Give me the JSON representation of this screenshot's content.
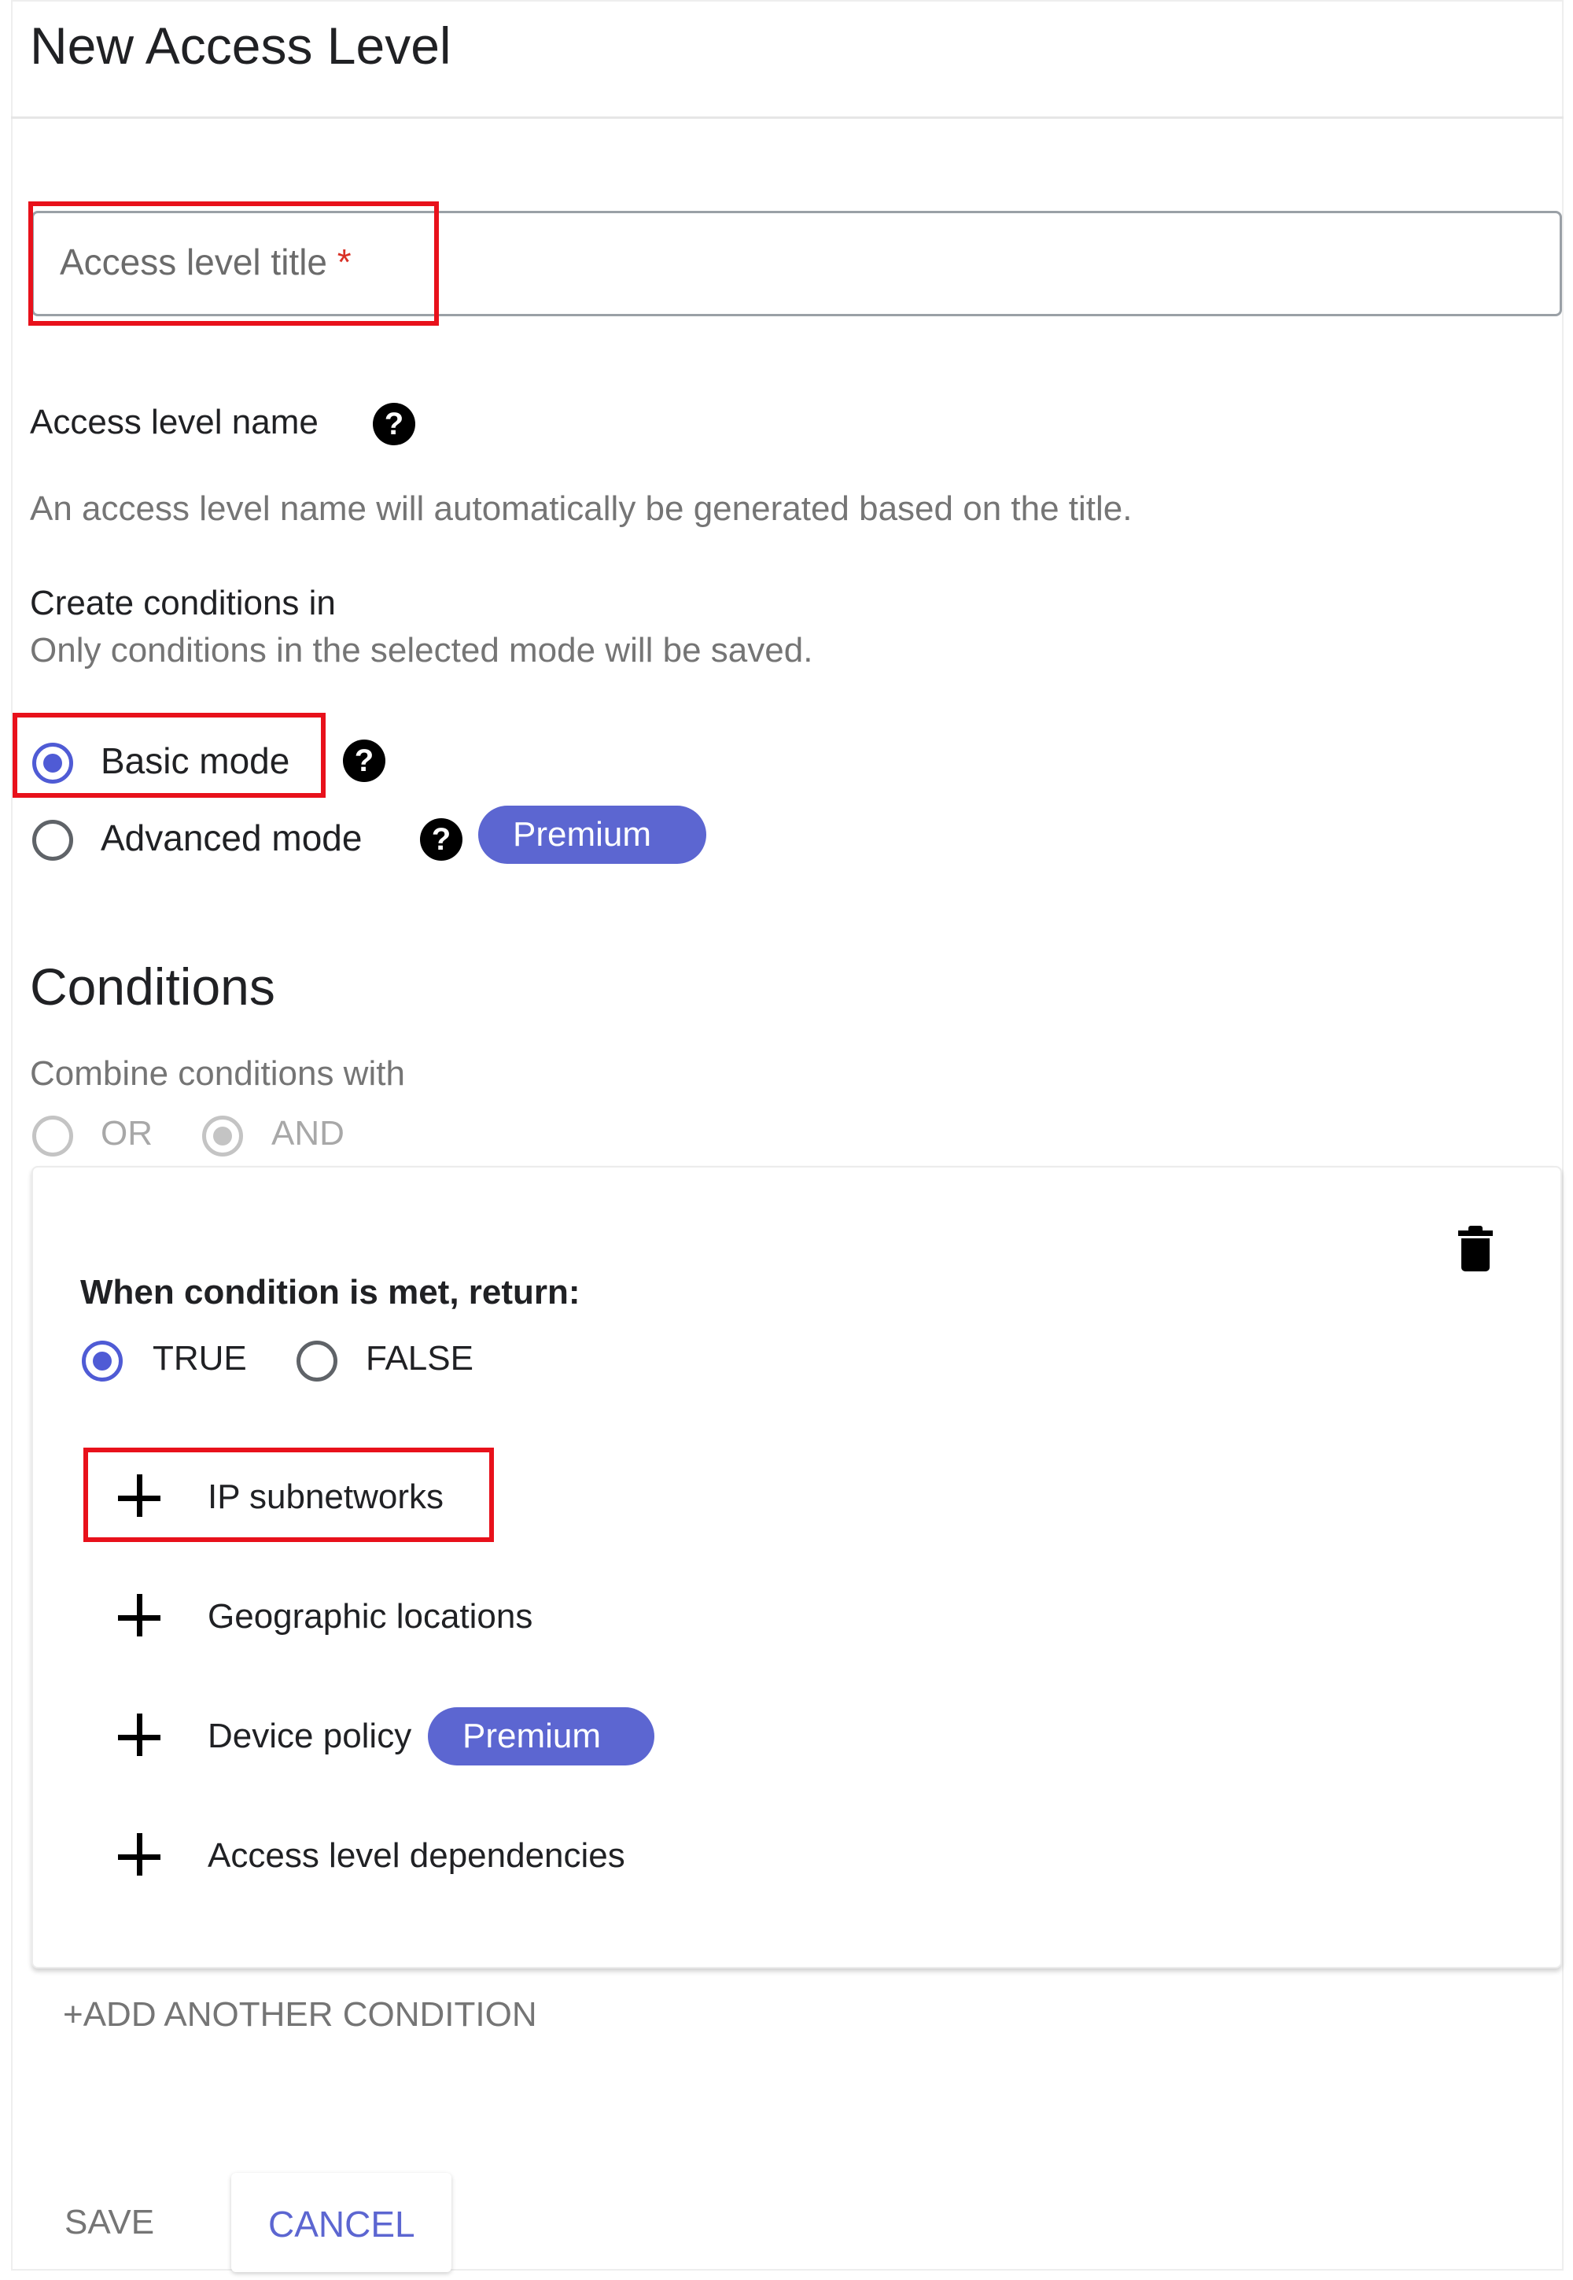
{
  "page": {
    "title": "New Access Level"
  },
  "title_field": {
    "placeholder": "Access level title",
    "required_mark": "*"
  },
  "access_level_name": {
    "label": "Access level name",
    "help_glyph": "?",
    "hint": "An access level name will automatically be generated based on the title."
  },
  "create_conditions": {
    "label": "Create conditions in",
    "hint": "Only conditions in the selected mode will be saved.",
    "modes": [
      {
        "label": "Basic mode",
        "selected": true,
        "help_glyph": "?"
      },
      {
        "label": "Advanced mode",
        "selected": false,
        "help_glyph": "?",
        "badge": "Premium"
      }
    ]
  },
  "conditions": {
    "heading": "Conditions",
    "combine_label": "Combine conditions with",
    "combine_options": [
      {
        "label": "OR",
        "selected": false,
        "disabled": true
      },
      {
        "label": "AND",
        "selected": true,
        "disabled": true
      }
    ],
    "card": {
      "return_label": "When condition is met, return:",
      "return_options": [
        {
          "label": "TRUE",
          "selected": true
        },
        {
          "label": "FALSE",
          "selected": false
        }
      ],
      "attributes": [
        {
          "label": "IP subnetworks"
        },
        {
          "label": "Geographic locations"
        },
        {
          "label": "Device policy",
          "badge": "Premium"
        },
        {
          "label": "Access level dependencies"
        }
      ],
      "delete_icon": "trash-icon"
    },
    "add_another": "+ADD ANOTHER CONDITION"
  },
  "actions": {
    "save_label": "SAVE",
    "cancel_label": "CANCEL"
  },
  "colors": {
    "accent": "#5c66d1",
    "highlight": "#e8111b",
    "required": "#d93025",
    "muted": "#757575"
  }
}
